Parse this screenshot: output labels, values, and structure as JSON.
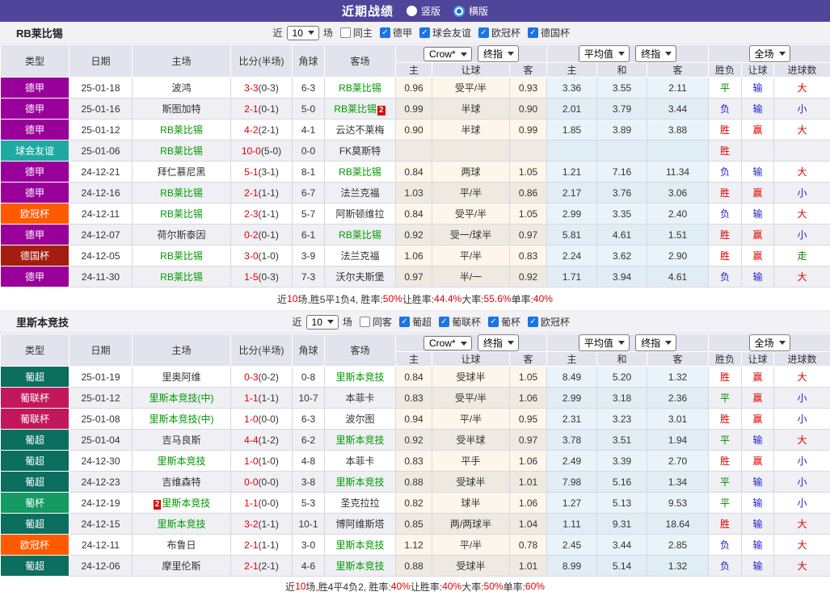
{
  "topbar": {
    "title": "近期战绩",
    "vertical_label": "竖版",
    "horizontal_label": "横版"
  },
  "colors": {
    "topbar_bg": "#4F469B",
    "checkbox_blue": "#1A73E8",
    "highlight_team": "#009900",
    "score_red": "#E00000",
    "red": "#E00000",
    "blue": "#2222CC",
    "green": "#008800",
    "leagues": {
      "德甲": "#990099",
      "球会友谊": "#1FA9A1",
      "欧冠杯": "#FF5A00",
      "德国杯": "#A31D10",
      "葡超": "#0B6E5E",
      "葡联杯": "#C2185B",
      "葡杯": "#149A62"
    },
    "results": {
      "胜": "#E00000",
      "平": "#008800",
      "负": "#2222CC",
      "赢": "#E00000",
      "输": "#2222CC",
      "走": "#008800",
      "大": "#E00000",
      "小": "#2222CC"
    }
  },
  "table": {
    "columns": [
      "类型",
      "日期",
      "主场",
      "比分(半场)",
      "角球",
      "客场"
    ],
    "subcolumns": [
      "主",
      "让球",
      "客",
      "主",
      "和",
      "客",
      "胜负",
      "让球",
      "进球数"
    ],
    "dropdowns": {
      "source": "Crow*",
      "stage": "终指",
      "avg": "平均值",
      "avg_stage": "终指",
      "scope": "全场"
    }
  },
  "sections": [
    {
      "team": "RB莱比锡",
      "filter": {
        "recent_label": "近",
        "count": "10",
        "matches_label": "场",
        "same_label": "同主",
        "leagues": [
          "德甲",
          "球会友谊",
          "欧冠杯",
          "德国杯"
        ]
      },
      "rows": [
        {
          "type": "德甲",
          "date": "25-01-18",
          "home": "波鸿",
          "score": "3-3",
          "half": "(0-3)",
          "corner": "6-3",
          "away": "RB莱比锡",
          "away_hl": true,
          "h": "0.96",
          "line": "受平/半",
          "a": "0.93",
          "mh": "3.36",
          "md": "3.55",
          "ma": "2.11",
          "r1": "平",
          "r2": "输",
          "r3": "大"
        },
        {
          "type": "德甲",
          "date": "25-01-16",
          "home": "斯图加特",
          "score": "2-1",
          "half": "(0-1)",
          "corner": "5-0",
          "away": "RB莱比锡",
          "away_hl": true,
          "away_badge_post": "2",
          "h": "0.99",
          "line": "半球",
          "a": "0.90",
          "mh": "2.01",
          "md": "3.79",
          "ma": "3.44",
          "r1": "负",
          "r2": "输",
          "r3": "小"
        },
        {
          "type": "德甲",
          "date": "25-01-12",
          "home": "RB莱比锡",
          "home_hl": true,
          "score": "4-2",
          "half": "(2-1)",
          "corner": "4-1",
          "away": "云达不莱梅",
          "h": "0.90",
          "line": "半球",
          "a": "0.99",
          "mh": "1.85",
          "md": "3.89",
          "ma": "3.88",
          "r1": "胜",
          "r2": "赢",
          "r3": "大"
        },
        {
          "type": "球会友谊",
          "date": "25-01-06",
          "home": "RB莱比锡",
          "home_hl": true,
          "score": "10-0",
          "half": "(5-0)",
          "corner": "0-0",
          "away": "FK莫斯特",
          "h": "",
          "line": "",
          "a": "",
          "mh": "",
          "md": "",
          "ma": "",
          "r1": "胜",
          "r2": "",
          "r3": ""
        },
        {
          "type": "德甲",
          "date": "24-12-21",
          "home": "拜仁慕尼黑",
          "score": "5-1",
          "half": "(3-1)",
          "corner": "8-1",
          "away": "RB莱比锡",
          "away_hl": true,
          "h": "0.84",
          "line": "两球",
          "a": "1.05",
          "mh": "1.21",
          "md": "7.16",
          "ma": "11.34",
          "r1": "负",
          "r2": "输",
          "r3": "大"
        },
        {
          "type": "德甲",
          "date": "24-12-16",
          "home": "RB莱比锡",
          "home_hl": true,
          "score": "2-1",
          "half": "(1-1)",
          "corner": "6-7",
          "away": "法兰克福",
          "h": "1.03",
          "line": "平/半",
          "a": "0.86",
          "mh": "2.17",
          "md": "3.76",
          "ma": "3.06",
          "r1": "胜",
          "r2": "赢",
          "r3": "小"
        },
        {
          "type": "欧冠杯",
          "date": "24-12-11",
          "home": "RB莱比锡",
          "home_hl": true,
          "score": "2-3",
          "half": "(1-1)",
          "corner": "5-7",
          "away": "阿斯顿维拉",
          "h": "0.84",
          "line": "受平/半",
          "a": "1.05",
          "mh": "2.99",
          "md": "3.35",
          "ma": "2.40",
          "r1": "负",
          "r2": "输",
          "r3": "大"
        },
        {
          "type": "德甲",
          "date": "24-12-07",
          "home": "荷尔斯泰因",
          "score": "0-2",
          "half": "(0-1)",
          "corner": "6-1",
          "away": "RB莱比锡",
          "away_hl": true,
          "h": "0.92",
          "line": "受一/球半",
          "a": "0.97",
          "mh": "5.81",
          "md": "4.61",
          "ma": "1.51",
          "r1": "胜",
          "r2": "赢",
          "r3": "小"
        },
        {
          "type": "德国杯",
          "date": "24-12-05",
          "home": "RB莱比锡",
          "home_hl": true,
          "score": "3-0",
          "half": "(1-0)",
          "corner": "3-9",
          "away": "法兰克福",
          "h": "1.06",
          "line": "平/半",
          "a": "0.83",
          "mh": "2.24",
          "md": "3.62",
          "ma": "2.90",
          "r1": "胜",
          "r2": "赢",
          "r3": "走"
        },
        {
          "type": "德甲",
          "date": "24-11-30",
          "home": "RB莱比锡",
          "home_hl": true,
          "score": "1-5",
          "half": "(0-3)",
          "corner": "7-3",
          "away": "沃尔夫斯堡",
          "h": "0.97",
          "line": "半/一",
          "a": "0.92",
          "mh": "1.71",
          "md": "3.94",
          "ma": "4.61",
          "r1": "负",
          "r2": "输",
          "r3": "大"
        }
      ],
      "summary": [
        {
          "t": "近"
        },
        {
          "t": "10",
          "red": true
        },
        {
          "t": "场,胜5平1负4, 胜率:"
        },
        {
          "t": "50%",
          "red": true
        },
        {
          "t": " 让胜率:"
        },
        {
          "t": "44.4%",
          "red": true
        },
        {
          "t": " 大率:"
        },
        {
          "t": "55.6%",
          "red": true
        },
        {
          "t": " 单率:"
        },
        {
          "t": "40%",
          "red": true
        }
      ]
    },
    {
      "team": "里斯本竞技",
      "filter": {
        "recent_label": "近",
        "count": "10",
        "matches_label": "场",
        "same_label": "同客",
        "leagues": [
          "葡超",
          "葡联杯",
          "葡杯",
          "欧冠杯"
        ]
      },
      "rows": [
        {
          "type": "葡超",
          "date": "25-01-19",
          "home": "里奥阿维",
          "score": "0-3",
          "half": "(0-2)",
          "corner": "0-8",
          "away": "里斯本竞技",
          "away_hl": true,
          "h": "0.84",
          "line": "受球半",
          "a": "1.05",
          "mh": "8.49",
          "md": "5.20",
          "ma": "1.32",
          "r1": "胜",
          "r2": "赢",
          "r3": "大"
        },
        {
          "type": "葡联杯",
          "date": "25-01-12",
          "home": "里斯本竞技(中)",
          "home_hl": true,
          "score": "1-1",
          "half": "(1-1)",
          "corner": "10-7",
          "away": "本菲卡",
          "h": "0.83",
          "line": "受平/半",
          "a": "1.06",
          "mh": "2.99",
          "md": "3.18",
          "ma": "2.36",
          "r1": "平",
          "r2": "赢",
          "r3": "小"
        },
        {
          "type": "葡联杯",
          "date": "25-01-08",
          "home": "里斯本竞技(中)",
          "home_hl": true,
          "score": "1-0",
          "half": "(0-0)",
          "corner": "6-3",
          "away": "波尔图",
          "h": "0.94",
          "line": "平/半",
          "a": "0.95",
          "mh": "2.31",
          "md": "3.23",
          "ma": "3.01",
          "r1": "胜",
          "r2": "赢",
          "r3": "小"
        },
        {
          "type": "葡超",
          "date": "25-01-04",
          "home": "吉马良斯",
          "score": "4-4",
          "half": "(1-2)",
          "corner": "6-2",
          "away": "里斯本竞技",
          "away_hl": true,
          "h": "0.92",
          "line": "受半球",
          "a": "0.97",
          "mh": "3.78",
          "md": "3.51",
          "ma": "1.94",
          "r1": "平",
          "r2": "输",
          "r3": "大"
        },
        {
          "type": "葡超",
          "date": "24-12-30",
          "home": "里斯本竞技",
          "home_hl": true,
          "score": "1-0",
          "half": "(1-0)",
          "corner": "4-8",
          "away": "本菲卡",
          "h": "0.83",
          "line": "平手",
          "a": "1.06",
          "mh": "2.49",
          "md": "3.39",
          "ma": "2.70",
          "r1": "胜",
          "r2": "赢",
          "r3": "小"
        },
        {
          "type": "葡超",
          "date": "24-12-23",
          "home": "吉维森特",
          "score": "0-0",
          "half": "(0-0)",
          "corner": "3-8",
          "away": "里斯本竞技",
          "away_hl": true,
          "h": "0.88",
          "line": "受球半",
          "a": "1.01",
          "mh": "7.98",
          "md": "5.16",
          "ma": "1.34",
          "r1": "平",
          "r2": "输",
          "r3": "小"
        },
        {
          "type": "葡杯",
          "date": "24-12-19",
          "home": "里斯本竞技",
          "home_hl": true,
          "home_badge_pre": "2",
          "score": "1-1",
          "half": "(0-0)",
          "corner": "5-3",
          "away": "圣克拉拉",
          "h": "0.82",
          "line": "球半",
          "a": "1.06",
          "mh": "1.27",
          "md": "5.13",
          "ma": "9.53",
          "r1": "平",
          "r2": "输",
          "r3": "小"
        },
        {
          "type": "葡超",
          "date": "24-12-15",
          "home": "里斯本竞技",
          "home_hl": true,
          "score": "3-2",
          "half": "(1-1)",
          "corner": "10-1",
          "away": "博阿维斯塔",
          "h": "0.85",
          "line": "两/两球半",
          "a": "1.04",
          "mh": "1.11",
          "md": "9.31",
          "ma": "18.64",
          "r1": "胜",
          "r2": "输",
          "r3": "大"
        },
        {
          "type": "欧冠杯",
          "date": "24-12-11",
          "home": "布鲁日",
          "score": "2-1",
          "half": "(1-1)",
          "corner": "3-0",
          "away": "里斯本竞技",
          "away_hl": true,
          "h": "1.12",
          "line": "平/半",
          "a": "0.78",
          "mh": "2.45",
          "md": "3.44",
          "ma": "2.85",
          "r1": "负",
          "r2": "输",
          "r3": "大"
        },
        {
          "type": "葡超",
          "date": "24-12-06",
          "home": "摩里伦斯",
          "score": "2-1",
          "half": "(2-1)",
          "corner": "4-6",
          "away": "里斯本竞技",
          "away_hl": true,
          "h": "0.88",
          "line": "受球半",
          "a": "1.01",
          "mh": "8.99",
          "md": "5.14",
          "ma": "1.32",
          "r1": "负",
          "r2": "输",
          "r3": "大"
        }
      ],
      "summary": [
        {
          "t": "近"
        },
        {
          "t": "10",
          "red": true
        },
        {
          "t": "场,胜4平4负2, 胜率:"
        },
        {
          "t": "40%",
          "red": true
        },
        {
          "t": " 让胜率:"
        },
        {
          "t": "40%",
          "red": true
        },
        {
          "t": " 大率:"
        },
        {
          "t": "50%",
          "red": true
        },
        {
          "t": " 单率:"
        },
        {
          "t": "60%",
          "red": true
        }
      ]
    }
  ]
}
